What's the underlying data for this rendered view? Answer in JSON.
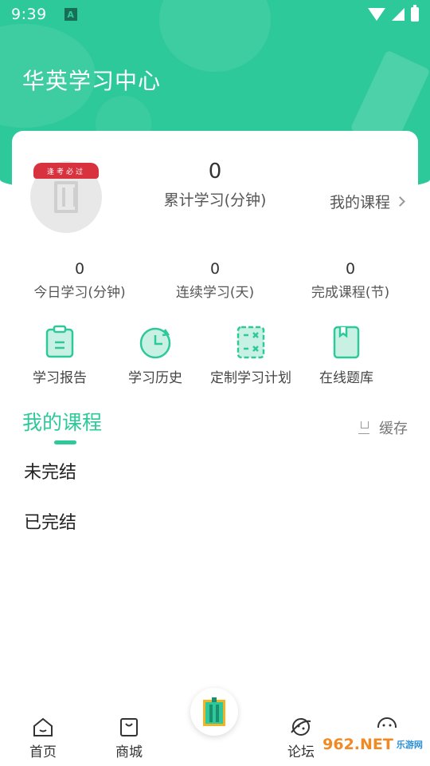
{
  "status_bar": {
    "time": "9:39",
    "notification_badge": "A"
  },
  "header": {
    "title": "华英学习中心"
  },
  "profile": {
    "ribbon_text": "逢考必过",
    "total_minutes": "0",
    "total_label": "累计学习(分钟)",
    "my_courses_link": "我的课程"
  },
  "stats": [
    {
      "value": "0",
      "label": "今日学习(分钟)"
    },
    {
      "value": "0",
      "label": "连续学习(天)"
    },
    {
      "value": "0",
      "label": "完成课程(节)"
    }
  ],
  "tools": [
    {
      "label": "学习报告",
      "icon": "clipboard-report-icon"
    },
    {
      "label": "学习历史",
      "icon": "history-clock-icon"
    },
    {
      "label": "定制学习计划",
      "icon": "calculator-plan-icon"
    },
    {
      "label": "在线题库",
      "icon": "bookmark-book-icon"
    }
  ],
  "courses_section": {
    "title": "我的课程",
    "cache_label": "缓存",
    "items": [
      "未完结",
      "已完结"
    ]
  },
  "tabbar": {
    "items": [
      {
        "label": "首页",
        "icon": "home-icon"
      },
      {
        "label": "商城",
        "icon": "shopping-bag-icon"
      },
      {
        "label": "论坛",
        "icon": "planet-icon"
      },
      {
        "label": "",
        "icon": "smiley-icon"
      }
    ],
    "center_icon": "app-logo-icon"
  },
  "watermark": {
    "text": "962.NET",
    "sub": "乐游网"
  },
  "colors": {
    "accent": "#2ec99a",
    "ribbon": "#d8323e"
  }
}
